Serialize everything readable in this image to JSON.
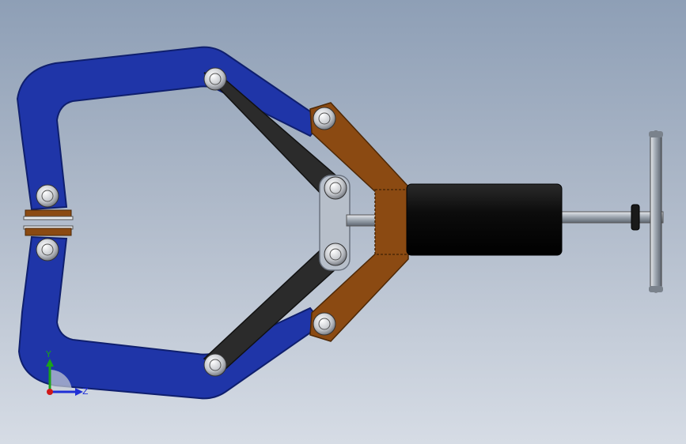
{
  "viewport": {
    "background_top": "#8e9fb6",
    "background_bottom": "#d6dce5"
  },
  "model": {
    "colors": {
      "frame": "#1f35a8",
      "frame_edge": "#0f1f6e",
      "link": "#2b2b2b",
      "arm": "#8b4a12",
      "arm_edge": "#4d2806",
      "cylinder": "#0c0c0c",
      "rod": "#9aa3ad",
      "bolt": "#d4d6da",
      "plate": "#b7bfca"
    }
  },
  "triad": {
    "y_label": "Y",
    "z_label": "Z",
    "y_color": "#1aa31a",
    "z_color": "#1f2fd6",
    "x_color": "#d01818"
  }
}
